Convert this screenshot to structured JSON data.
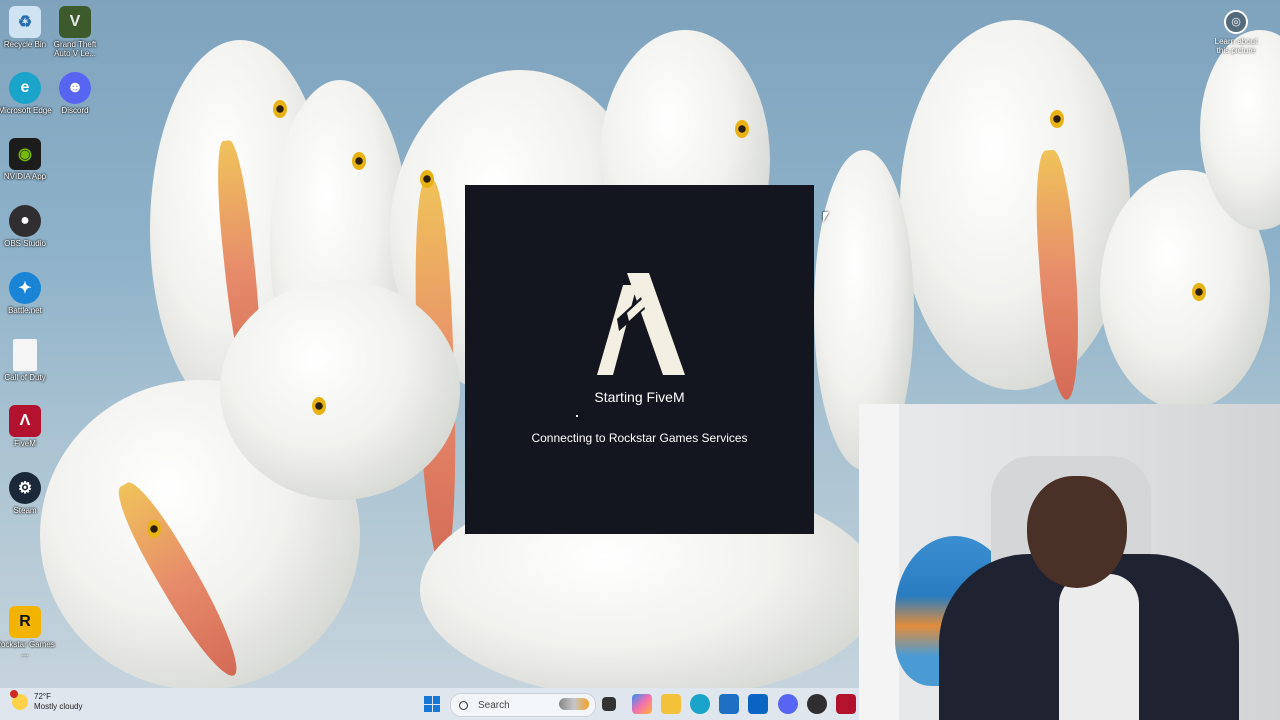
{
  "desktop": {
    "icons": [
      {
        "label": "Recycle Bin",
        "icon": "recycle-bin-icon",
        "color": "#cfe3f2"
      },
      {
        "label": "Grand Theft Auto V Le...",
        "icon": "gta-icon",
        "color": "#3c5a2c"
      },
      {
        "label": "Microsoft Edge",
        "icon": "edge-icon",
        "color": "#1aa4c9"
      },
      {
        "label": "Discord",
        "icon": "discord-icon",
        "color": "#5865f2"
      },
      {
        "label": "NVIDIA App",
        "icon": "nvidia-icon",
        "color": "#1c1c1c"
      },
      {
        "label": "OBS Studio",
        "icon": "obs-icon",
        "color": "#302e31"
      },
      {
        "label": "Battle.net",
        "icon": "battlenet-icon",
        "color": "#1a85d6"
      },
      {
        "label": "Call of Duty",
        "icon": "file-icon",
        "color": "#f5f5f5"
      },
      {
        "label": "FiveM",
        "icon": "fivem-icon",
        "color": "#b3122e"
      },
      {
        "label": "Steam",
        "icon": "steam-icon",
        "color": "#1b2838"
      },
      {
        "label": "Rockstar Games ...",
        "icon": "rockstar-icon",
        "color": "#f2b400"
      }
    ],
    "learn_about": "Learn about this picture"
  },
  "splash": {
    "title": "Starting FiveM",
    "status": "Connecting to Rockstar Games Services"
  },
  "taskbar": {
    "weather_temp": "72°F",
    "weather_desc": "Mostly cloudy",
    "search_placeholder": "Search",
    "apps": [
      "task-view-icon",
      "copilot-icon",
      "file-explorer-icon",
      "edge-icon",
      "store-icon",
      "outlook-icon",
      "discord-icon",
      "obs-icon",
      "fivem-icon"
    ]
  },
  "colors": {
    "splash_bg": "#13151f",
    "logo": "#f3efe3",
    "taskbar_bg": "#dfe6ee"
  }
}
